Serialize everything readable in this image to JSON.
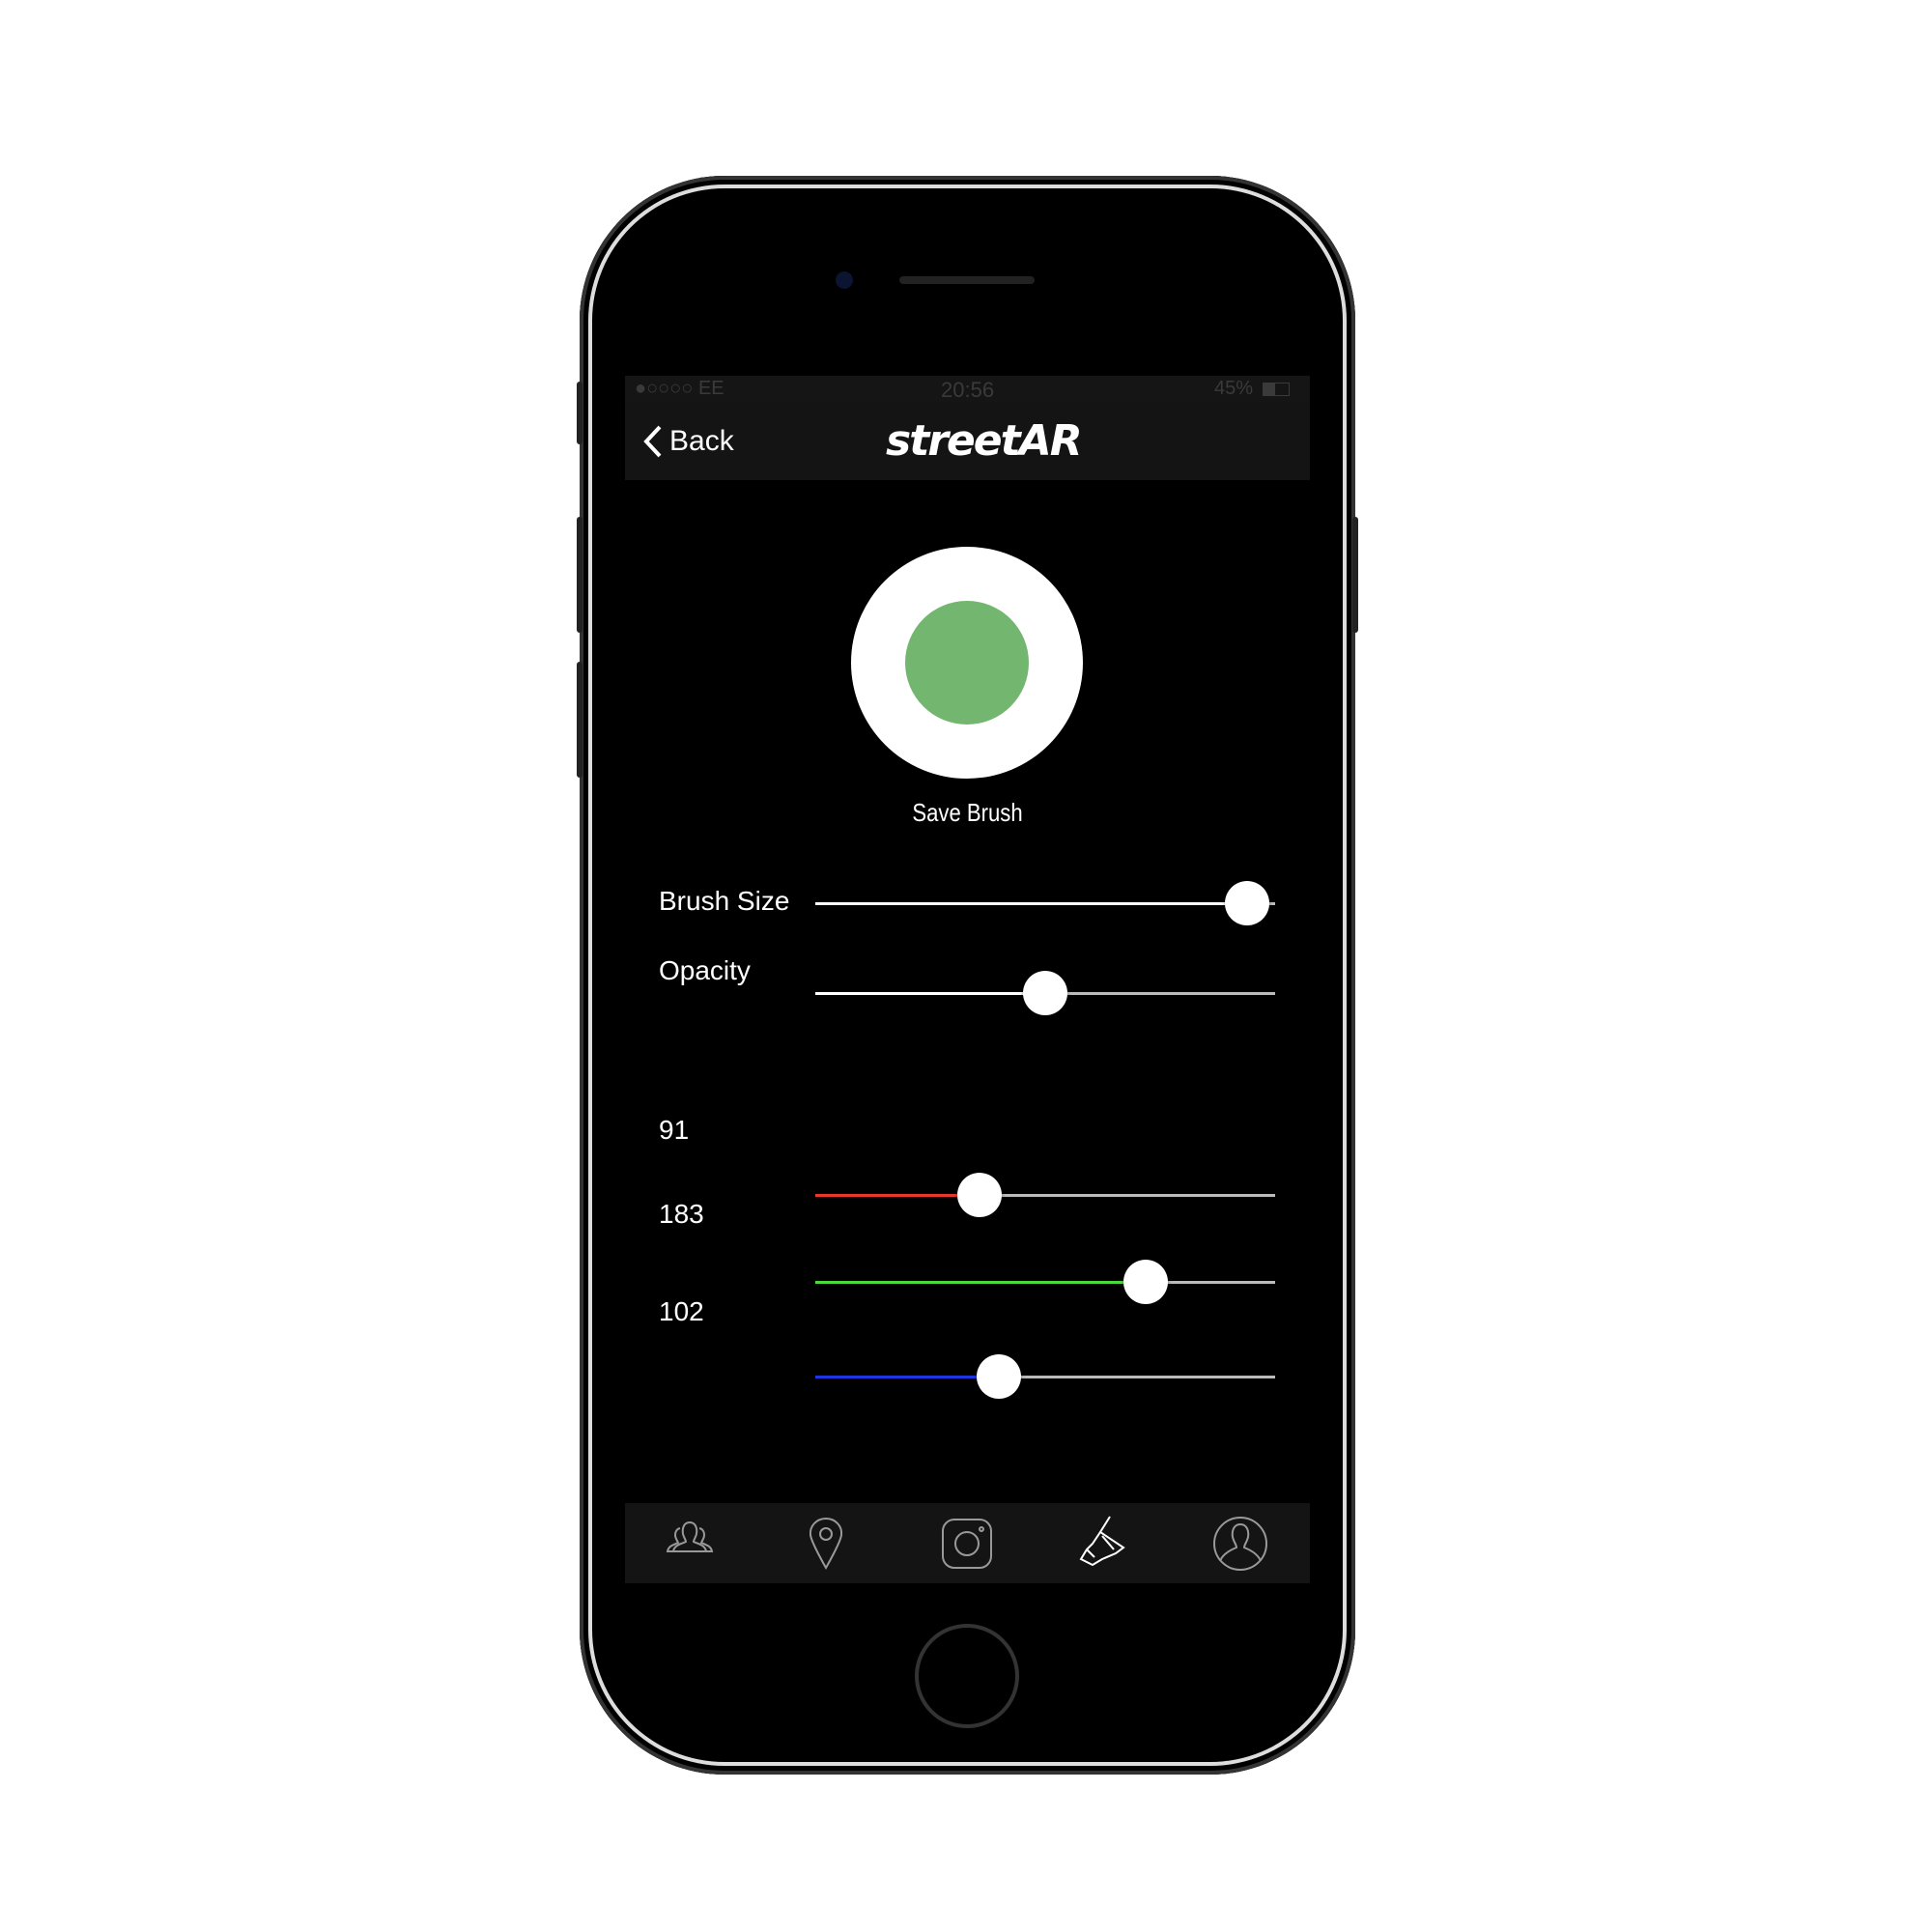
{
  "status_bar": {
    "carrier": "●○○○○ EE",
    "time": "20:56",
    "battery": "45%"
  },
  "nav": {
    "back_label": "Back",
    "logo_text": "streetAR"
  },
  "brush_preview": {
    "color": "#73b66f",
    "save_label": "Save Brush"
  },
  "sliders": {
    "brush_size": {
      "label": "Brush Size",
      "value": 0.94
    },
    "opacity": {
      "label": "Opacity",
      "value": 0.5
    },
    "red": {
      "label": "91",
      "value": 91,
      "max": 255,
      "color": "#e8382c"
    },
    "green": {
      "label": "183",
      "value": 183,
      "max": 255,
      "color": "#4cd93a"
    },
    "blue": {
      "label": "102",
      "value": 102,
      "max": 255,
      "color": "#1f35e0"
    }
  },
  "tab_bar": {
    "items": [
      {
        "icon": "community-icon"
      },
      {
        "icon": "location-pin-icon"
      },
      {
        "icon": "camera-icon"
      },
      {
        "icon": "brush-icon",
        "active": true
      },
      {
        "icon": "profile-icon"
      }
    ]
  }
}
